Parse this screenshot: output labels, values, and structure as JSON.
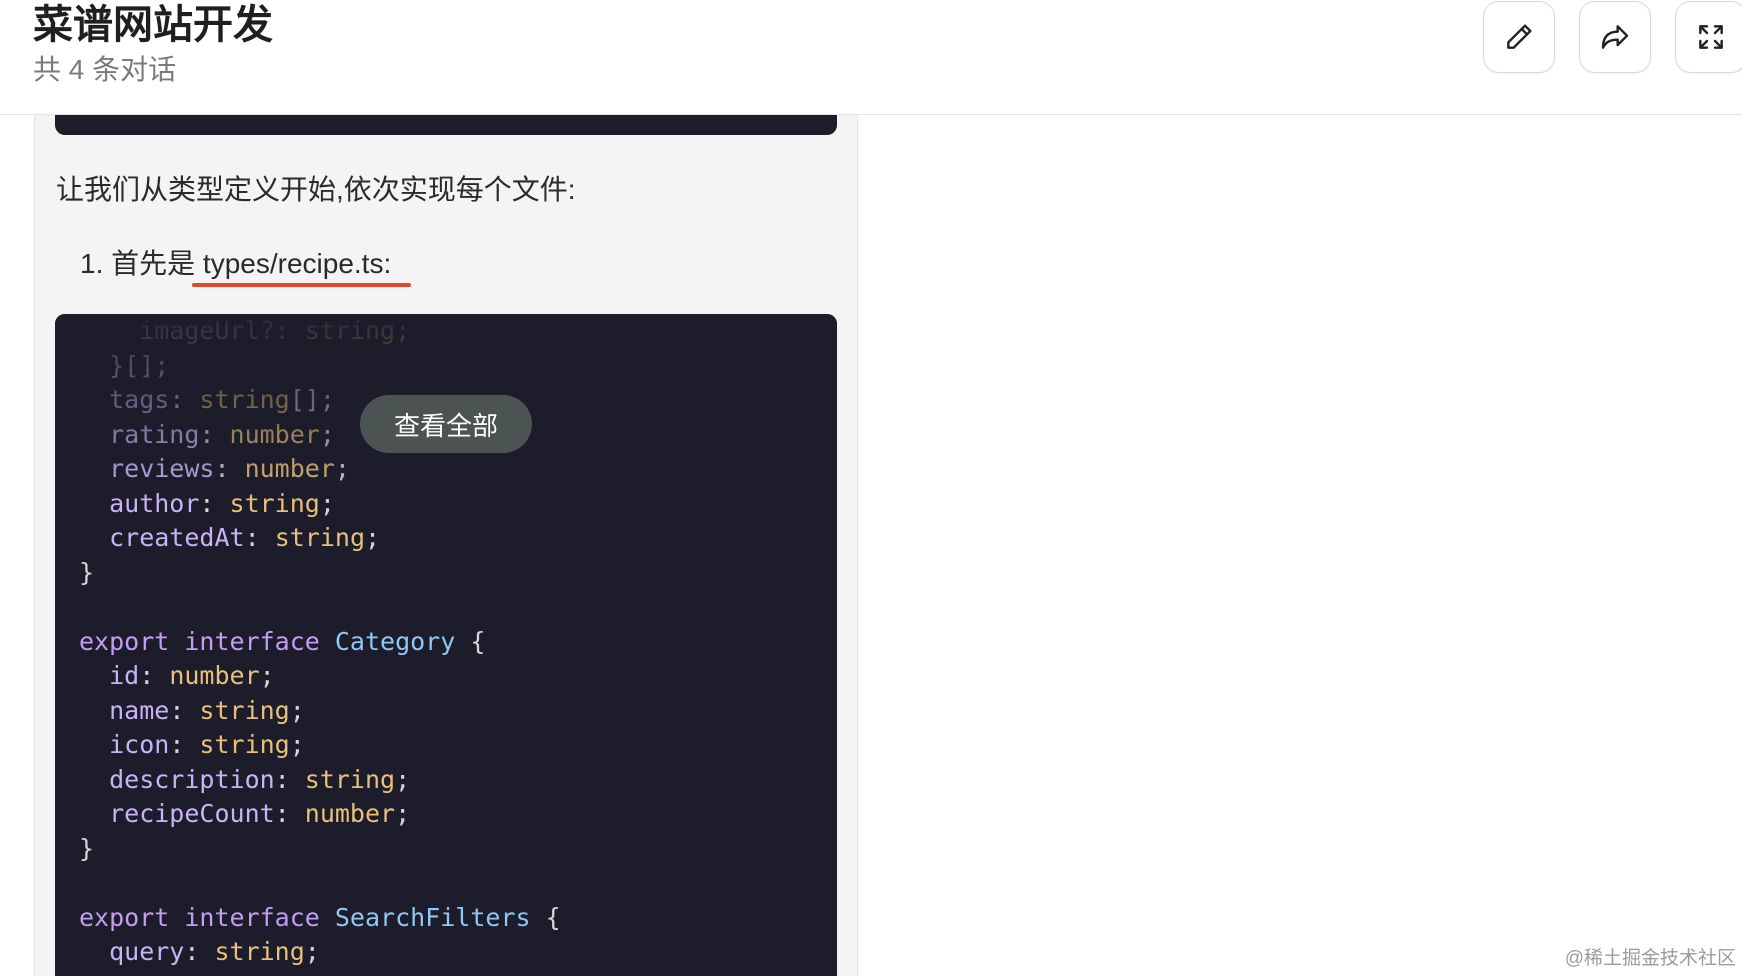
{
  "header": {
    "title": "菜谱网站开发",
    "subtitle": "共 4 条对话",
    "buttons": [
      {
        "icon": "pencil-icon"
      },
      {
        "icon": "share-icon"
      },
      {
        "icon": "fullscreen-icon"
      }
    ]
  },
  "content": {
    "intro": "让我们从类型定义开始,依次实现每个文件:",
    "list_item_prefix": "1. 首先是 ",
    "list_item_file": "types/recipe.ts:",
    "view_all_label": "查看全部"
  },
  "code_lines": [
    [
      {
        "t": "    imageUrl?: ",
        "c": "p"
      },
      {
        "t": "string;",
        "c": "t"
      }
    ],
    [
      {
        "t": "  }[];",
        "c": "d"
      }
    ],
    [
      {
        "t": "  tags",
        "c": "p"
      },
      {
        "t": ": ",
        "c": "d"
      },
      {
        "t": "string",
        "c": "t"
      },
      {
        "t": "[];",
        "c": "d"
      }
    ],
    [
      {
        "t": "  rating",
        "c": "p"
      },
      {
        "t": ": ",
        "c": "d"
      },
      {
        "t": "number",
        "c": "t"
      },
      {
        "t": ";",
        "c": "d"
      }
    ],
    [
      {
        "t": "  reviews",
        "c": "p"
      },
      {
        "t": ": ",
        "c": "d"
      },
      {
        "t": "number",
        "c": "t"
      },
      {
        "t": ";",
        "c": "d"
      }
    ],
    [
      {
        "t": "  author",
        "c": "p"
      },
      {
        "t": ": ",
        "c": "d"
      },
      {
        "t": "string",
        "c": "t"
      },
      {
        "t": ";",
        "c": "d"
      }
    ],
    [
      {
        "t": "  createdAt",
        "c": "p"
      },
      {
        "t": ": ",
        "c": "d"
      },
      {
        "t": "string",
        "c": "t"
      },
      {
        "t": ";",
        "c": "d"
      }
    ],
    [
      {
        "t": "}",
        "c": "d"
      }
    ],
    [
      {
        "t": "",
        "c": "d"
      }
    ],
    [
      {
        "t": "export ",
        "c": "k"
      },
      {
        "t": "interface ",
        "c": "k"
      },
      {
        "t": "Category",
        "c": "c"
      },
      {
        "t": " {",
        "c": "d"
      }
    ],
    [
      {
        "t": "  id",
        "c": "p"
      },
      {
        "t": ": ",
        "c": "d"
      },
      {
        "t": "number",
        "c": "t"
      },
      {
        "t": ";",
        "c": "d"
      }
    ],
    [
      {
        "t": "  name",
        "c": "p"
      },
      {
        "t": ": ",
        "c": "d"
      },
      {
        "t": "string",
        "c": "t"
      },
      {
        "t": ";",
        "c": "d"
      }
    ],
    [
      {
        "t": "  icon",
        "c": "p"
      },
      {
        "t": ": ",
        "c": "d"
      },
      {
        "t": "string",
        "c": "t"
      },
      {
        "t": ";",
        "c": "d"
      }
    ],
    [
      {
        "t": "  description",
        "c": "p"
      },
      {
        "t": ": ",
        "c": "d"
      },
      {
        "t": "string",
        "c": "t"
      },
      {
        "t": ";",
        "c": "d"
      }
    ],
    [
      {
        "t": "  recipeCount",
        "c": "p"
      },
      {
        "t": ": ",
        "c": "d"
      },
      {
        "t": "number",
        "c": "t"
      },
      {
        "t": ";",
        "c": "d"
      }
    ],
    [
      {
        "t": "}",
        "c": "d"
      }
    ],
    [
      {
        "t": "",
        "c": "d"
      }
    ],
    [
      {
        "t": "export ",
        "c": "k"
      },
      {
        "t": "interface ",
        "c": "k"
      },
      {
        "t": "SearchFilters",
        "c": "c"
      },
      {
        "t": " {",
        "c": "d"
      }
    ],
    [
      {
        "t": "  query",
        "c": "p"
      },
      {
        "t": ": ",
        "c": "d"
      },
      {
        "t": "string",
        "c": "t"
      },
      {
        "t": ";",
        "c": "d"
      }
    ]
  ],
  "watermark": "@稀土掘金技术社区"
}
